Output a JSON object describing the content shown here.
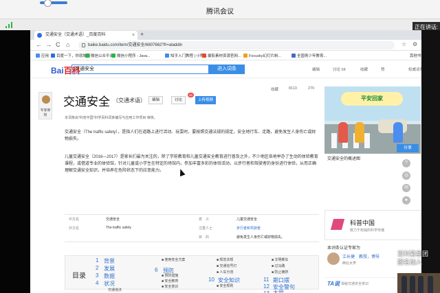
{
  "meeting": {
    "title": "腾讯会议",
    "speaker_label": "正在讲话:"
  },
  "browser": {
    "tab_title": "交通安全（交通术语）_百度百科",
    "tab_close": "×",
    "new_tab": "+",
    "url": "baike.baidu.com/item/交通安全/6807662?fr=aladdin",
    "nav": {
      "back": "←",
      "forward": "→",
      "reload": "C",
      "home": "⌂"
    },
    "bookmarks": [
      {
        "label": "应用",
        "color": "#4a8ef0"
      },
      {
        "label": "百度一下，你就知道",
        "color": "#2f6be0"
      },
      {
        "label": "微信公众平台",
        "color": "#2db34a"
      },
      {
        "label": "微信小程序 - Java...",
        "color": "#2db34a"
      },
      {
        "label": "知乎入门教程 | 小程...",
        "color": "#3a8ee6"
      },
      {
        "label": "摄影素材资源官网...",
        "color": "#e04a2a"
      },
      {
        "label": "Focusky幻灯片制...",
        "color": "#f0a020"
      },
      {
        "label": "全国青少年教育...",
        "color": "#4a6ac0"
      }
    ],
    "bookmarks_other": "其他书签"
  },
  "baike": {
    "logo_left": "Bai",
    "logo_right": "百科",
    "search_value": "交通安全",
    "search_button": "进入词条",
    "tools": [
      "编辑",
      "讨论",
      "收藏",
      "赞"
    ],
    "tools_counts": [
      "讨论 58"
    ],
    "header_right": "权威词条",
    "side_badge": "专家审核",
    "entry_title": "交通安全",
    "entry_sub": "（交通术语）",
    "edit_label": "编辑",
    "discuss_label": "讨论",
    "discuss_badge": "58",
    "upload_label": "上传视频",
    "stats": {
      "fav": "收藏",
      "likes": "8113",
      "shares": "270"
    },
    "note": "本词条由“科普中国”科学百科词条编写与应用工作项目 审核。",
    "para1": "交通安全（The traffic safety），是指人们在道路上进行活动、玩耍时，要按照交通法规的规定，安全地行车、走路，避免发生人身伤亡或财物损失。",
    "para2": "儿童交通安全（2016—2017）是家长们最为关注的，除了学前教育和儿童交通安全教育进行普及之外，不少地区各地举办了生动的体验教育课程，或借道专业的体验馆，针对儿童或小学生在特定的场馆内，参加丰富多彩的体验活动，以步行者和驾驶者的身份进行体验，从而正确理解交通安全知识，并培养在危险状态下的应变能力。",
    "info": [
      {
        "k1": "中文名",
        "v1": "交通安全",
        "k2": "意　义",
        "v2": "儿童交通安全"
      },
      {
        "k1": "外文名",
        "v1": "The traffic safety",
        "k2": "注重人士",
        "v2": "步行者和驾驶者"
      },
      {
        "k1": "",
        "v1": "",
        "k2": "目　的",
        "v2": "避免发生人身伤亡或财物损失。"
      }
    ],
    "toc_title": "目录",
    "toc_col1": [
      {
        "n": "1",
        "label": "背景"
      },
      {
        "n": "2",
        "label": "发展"
      },
      {
        "n": "3",
        "label": "数据"
      },
      {
        "n": "4",
        "label": "状况"
      }
    ],
    "toc_col1_sub": "交通违法",
    "toc_col2": [
      "■ 使用安全方案",
      "预防",
      "■ 预防措施",
      "■ 安全教育",
      "■ 安全意识"
    ],
    "toc_col2_num": "6",
    "toc_col3": [
      "■ 规范法规",
      "■ 交通信号灯",
      "■ 人车分流",
      "安全知识",
      "■ 安全规则"
    ],
    "toc_col3_num": "10",
    "toc_col4": [
      "■ 文明乘车",
      "■ 过马路",
      "■ 防止拥挤",
      "期口摆",
      "安全警句",
      "大世"
    ],
    "toc_col4_nums": [
      "11",
      "12",
      "13"
    ],
    "illus_banner": "平安回家",
    "illus_caption": "交通安全的概述图",
    "kp_title": "科普中国",
    "kp_sub": "致力于权威的科学传播",
    "auth_title": "本词条认证专家为",
    "auth_name": "江长捷　教授，博导",
    "auth_org": "西北大学",
    "ta_logo": "TA说",
    "ta_text": "揭秘交通安全常识",
    "share_label": "分享",
    "share_icons": [
      "?",
      "◎",
      "✉",
      "●"
    ]
  },
  "promo": {
    "line1": "百科繁星团",
    "line2": "报名加入"
  },
  "colors": {
    "accent": "#3a8ee6",
    "meeting_bg": "#f4f4f4",
    "brand_red": "#e02020"
  }
}
